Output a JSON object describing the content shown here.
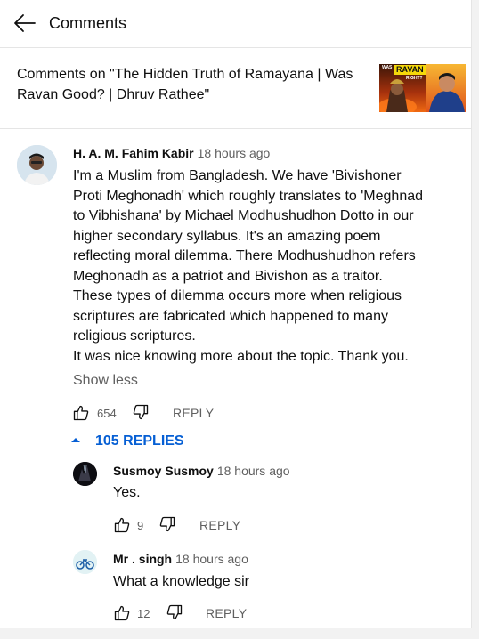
{
  "header": {
    "title": "Comments",
    "back_icon": "arrow-left-icon"
  },
  "video": {
    "title": "Comments on \"The Hidden Truth of Ramayana | Was Ravan Good? | Dhruv Rathee\"",
    "thumbnail": {
      "tag_was": "WAS",
      "tag_ravan": "RAVAN",
      "tag_right": "RIGHT?"
    }
  },
  "comment": {
    "author": "H. A. M. Fahim Kabir",
    "time": "18 hours ago",
    "lines": [
      "I'm a Muslim from Bangladesh. We have 'Bivishoner",
      "Proti Meghonadh' which roughly translates to 'Meghnad",
      "to Vibhishana' by Michael Modhushudhon Dotto in our",
      "higher secondary syllabus. It's an amazing poem",
      "reflecting moral dilemma. There Modhushudhon refers",
      "Meghonadh as a patriot and Bivishon as a traitor.",
      "These types of dilemma occurs more when religious",
      "scriptures are fabricated which happened to many",
      "religious scriptures.",
      "It was nice knowing more about the topic. Thank you."
    ],
    "show_less": "Show less",
    "likes": "654",
    "reply_label": "REPLY"
  },
  "replies_toggle": {
    "label": "105 REPLIES",
    "accent": "#065fd4"
  },
  "replies": [
    {
      "author": "Susmoy Susmoy",
      "time": "18 hours ago",
      "text": "Yes.",
      "likes": "9",
      "reply_label": "REPLY"
    },
    {
      "author": "Mr . singh",
      "time": "18 hours ago",
      "text": "What a knowledge sir",
      "likes": "12",
      "reply_label": "REPLY"
    }
  ],
  "colors": {
    "text": "#0f0f0f",
    "secondary": "#606060",
    "divider": "#e5e5e5"
  }
}
